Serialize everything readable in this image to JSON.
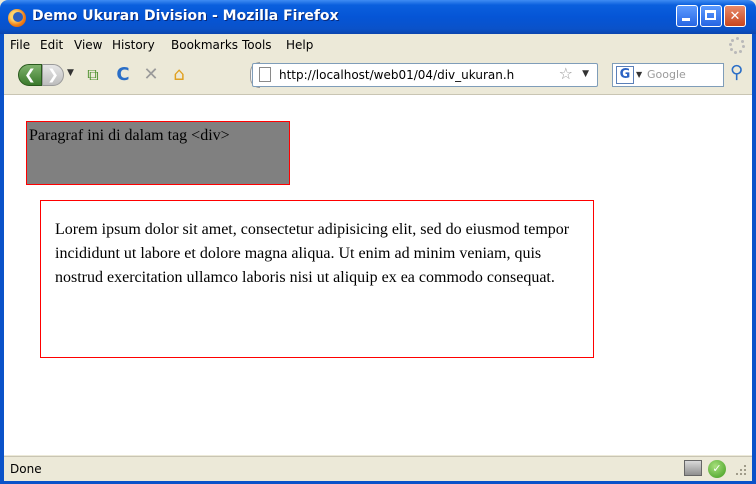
{
  "window": {
    "title": "Demo Ukuran Division - Mozilla Firefox"
  },
  "menu": {
    "items": [
      "File",
      "Edit",
      "View",
      "History",
      "Bookmarks",
      "Tools",
      "Help"
    ]
  },
  "navbar": {
    "url": "http://localhost/web01/04/div_ukuran.h",
    "search_placeholder": "Google",
    "search_engine_letter": "G"
  },
  "content": {
    "div1_text": "Paragraf ini di dalam tag <div>",
    "div2_text": "Lorem ipsum dolor sit amet, consectetur adipisicing elit, sed do eiusmod tempor incididunt ut labore et dolore magna aliqua. Ut enim ad minim veniam, quis nostrud exercitation ullamco laboris nisi ut aliquip ex ea commodo consequat."
  },
  "status": {
    "text": "Done"
  },
  "colors": {
    "titlebar": "#0555d6",
    "div_background": "#808080",
    "div_border": "#ff0000"
  }
}
